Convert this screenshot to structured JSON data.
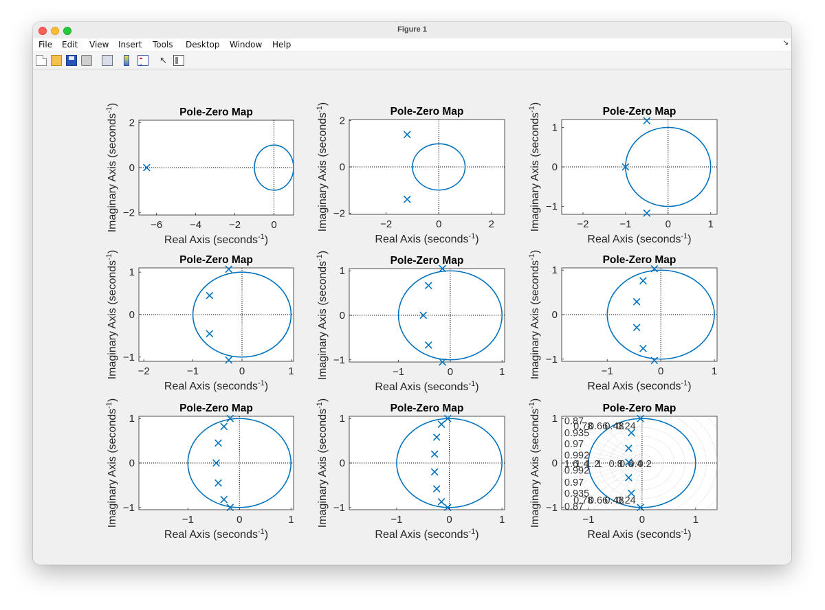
{
  "window": {
    "title": "Figure 1"
  },
  "menu": [
    "File",
    "Edit",
    "View",
    "Insert",
    "Tools",
    "Desktop",
    "Window",
    "Help"
  ],
  "toolbar_icons": [
    "new-figure-icon",
    "open-file-icon",
    "save-icon",
    "print-icon",
    "link-plot-icon",
    "insert-colorbar-icon",
    "insert-legend-icon",
    "edit-plot-arrow-icon",
    "property-inspector-icon"
  ],
  "colors": {
    "marker": "#0072BD",
    "circle": "#0072BD",
    "axis_text": "#262626",
    "dotted": "#000000"
  },
  "chart_data": [
    {
      "type": "scatter",
      "title": "Pole-Zero Map",
      "xlabel": "Real Axis (seconds",
      "ylabel": "Imaginary Axis (seconds",
      "label_exp": "-1",
      "xlim": [
        -6.9,
        1
      ],
      "ylim": [
        -2.1,
        2.1
      ],
      "xticks": [
        -6,
        -4,
        -2,
        0
      ],
      "yticks": [
        -2,
        0,
        2
      ],
      "unit_circle": true,
      "grid": false,
      "poles": [
        [
          -6.5,
          0
        ]
      ]
    },
    {
      "type": "scatter",
      "title": "Pole-Zero Map",
      "xlabel": "Real Axis (seconds",
      "ylabel": "Imaginary Axis (seconds",
      "label_exp": "-1",
      "xlim": [
        -3.4,
        2.5
      ],
      "ylim": [
        -2.05,
        2.05
      ],
      "xticks": [
        -2,
        0,
        2
      ],
      "yticks": [
        -2,
        0,
        2
      ],
      "unit_circle": true,
      "grid": false,
      "poles": [
        [
          -1.2,
          1.4
        ],
        [
          -1.2,
          -1.4
        ]
      ]
    },
    {
      "type": "scatter",
      "title": "Pole-Zero Map",
      "xlabel": "Real Axis (seconds",
      "ylabel": "Imaginary Axis (seconds",
      "label_exp": "-1",
      "xlim": [
        -2.5,
        1.15
      ],
      "ylim": [
        -1.2,
        1.2
      ],
      "xticks": [
        -2,
        -1,
        0,
        1
      ],
      "yticks": [
        -1,
        0,
        1
      ],
      "unit_circle": true,
      "grid": false,
      "poles": [
        [
          -1.0,
          0
        ],
        [
          -0.5,
          1.17
        ],
        [
          -0.5,
          -1.17
        ]
      ]
    },
    {
      "type": "scatter",
      "title": "Pole-Zero Map",
      "xlabel": "Real Axis (seconds",
      "ylabel": "Imaginary Axis (seconds",
      "label_exp": "-1",
      "xlim": [
        -2.1,
        1.05
      ],
      "ylim": [
        -1.1,
        1.1
      ],
      "xticks": [
        -2,
        -1,
        0,
        1
      ],
      "yticks": [
        -1,
        0,
        1
      ],
      "unit_circle": true,
      "grid": false,
      "poles": [
        [
          -0.27,
          1.07
        ],
        [
          -0.66,
          0.45
        ],
        [
          -0.66,
          -0.45
        ],
        [
          -0.27,
          -1.07
        ]
      ]
    },
    {
      "type": "scatter",
      "title": "Pole-Zero Map",
      "xlabel": "Real Axis (seconds",
      "ylabel": "Imaginary Axis (seconds",
      "label_exp": "-1",
      "xlim": [
        -1.95,
        1.05
      ],
      "ylim": [
        -1.05,
        1.05
      ],
      "xticks": [
        -1,
        0,
        1
      ],
      "yticks": [
        -1,
        0,
        1
      ],
      "unit_circle": true,
      "grid": false,
      "poles": [
        [
          -0.15,
          1.05
        ],
        [
          -0.42,
          0.67
        ],
        [
          -0.52,
          0
        ],
        [
          -0.42,
          -0.67
        ],
        [
          -0.15,
          -1.05
        ]
      ]
    },
    {
      "type": "scatter",
      "title": "Pole-Zero Map",
      "xlabel": "Real Axis (seconds",
      "ylabel": "Imaginary Axis (seconds",
      "label_exp": "-1",
      "xlim": [
        -1.85,
        1.05
      ],
      "ylim": [
        -1.05,
        1.05
      ],
      "xticks": [
        -1,
        0,
        1
      ],
      "yticks": [
        -1,
        0,
        1
      ],
      "unit_circle": true,
      "grid": false,
      "poles": [
        [
          -0.12,
          1.03
        ],
        [
          -0.33,
          0.76
        ],
        [
          -0.45,
          0.29
        ],
        [
          -0.45,
          -0.29
        ],
        [
          -0.33,
          -0.76
        ],
        [
          -0.12,
          -1.03
        ]
      ]
    },
    {
      "type": "scatter",
      "title": "Pole-Zero Map",
      "xlabel": "Real Axis (seconds",
      "ylabel": "Imaginary Axis (seconds",
      "label_exp": "-1",
      "xlim": [
        -1.95,
        1.05
      ],
      "ylim": [
        -1.05,
        1.05
      ],
      "xticks": [
        -1,
        0,
        1
      ],
      "yticks": [
        -1,
        0,
        1
      ],
      "unit_circle": true,
      "grid": false,
      "poles": [
        [
          -0.18,
          1.0
        ],
        [
          -0.3,
          0.82
        ],
        [
          -0.41,
          0.45
        ],
        [
          -0.45,
          0
        ],
        [
          -0.41,
          -0.45
        ],
        [
          -0.3,
          -0.82
        ],
        [
          -0.18,
          -1.0
        ]
      ]
    },
    {
      "type": "scatter",
      "title": "Pole-Zero Map",
      "xlabel": "Real Axis (seconds",
      "ylabel": "Imaginary Axis (seconds",
      "label_exp": "-1",
      "xlim": [
        -1.9,
        1.05
      ],
      "ylim": [
        -1.05,
        1.05
      ],
      "xticks": [
        -1,
        0,
        1
      ],
      "yticks": [
        -1,
        0,
        1
      ],
      "unit_circle": true,
      "grid": false,
      "poles": [
        [
          -0.03,
          1.0
        ],
        [
          -0.15,
          0.87
        ],
        [
          -0.24,
          0.58
        ],
        [
          -0.28,
          0.2
        ],
        [
          -0.28,
          -0.2
        ],
        [
          -0.24,
          -0.58
        ],
        [
          -0.15,
          -0.87
        ],
        [
          -0.03,
          -1.0
        ]
      ]
    },
    {
      "type": "scatter",
      "title": "Pole-Zero Map",
      "xlabel": "Real Axis (seconds",
      "ylabel": "Imaginary Axis (seconds",
      "label_exp": "-1",
      "xlim": [
        -1.5,
        1.4
      ],
      "ylim": [
        -1.05,
        1.05
      ],
      "xticks": [
        -1,
        0,
        1
      ],
      "yticks": [
        -1,
        0,
        1
      ],
      "unit_circle": true,
      "grid": true,
      "poles": [
        [
          -0.03,
          1.0
        ],
        [
          -0.2,
          0.68
        ],
        [
          -0.25,
          0.33
        ],
        [
          -0.25,
          0.02
        ],
        [
          -0.25,
          -0.33
        ],
        [
          -0.2,
          -0.68
        ],
        [
          -0.03,
          -1.0
        ]
      ],
      "grid_label_rows": [
        {
          "y": 0.95,
          "text": "0.87"
        },
        {
          "y": 0.83,
          "text": "0.78"
        },
        {
          "y": 0.83,
          "text": "0.66"
        },
        {
          "y": 0.83,
          "text": "0.48"
        },
        {
          "y": 0.83,
          "text": "0.24"
        },
        {
          "y": 0.68,
          "text": "0.935"
        },
        {
          "y": 0.43,
          "text": "0.97"
        },
        {
          "y": 0.18,
          "text": "0.992"
        },
        {
          "y": -0.16,
          "text": "0.992"
        },
        {
          "y": -0.43,
          "text": "0.97"
        },
        {
          "y": -0.68,
          "text": "0.935"
        },
        {
          "y": -0.83,
          "text": "0.78"
        },
        {
          "y": -0.83,
          "text": "0.66"
        },
        {
          "y": -0.83,
          "text": "0.48"
        },
        {
          "y": -0.83,
          "text": "0.24"
        },
        {
          "y": -0.97,
          "text": "0.87"
        }
      ],
      "grid_label_cols": [
        "1.6",
        "1.4",
        "1.2",
        "1",
        "0.8",
        "0.6",
        "0.4",
        "0.2"
      ],
      "grid_label_x": [
        -1.45,
        -1.25,
        -1.05,
        -0.85,
        -0.62,
        -0.42,
        -0.25,
        -0.08
      ]
    }
  ]
}
